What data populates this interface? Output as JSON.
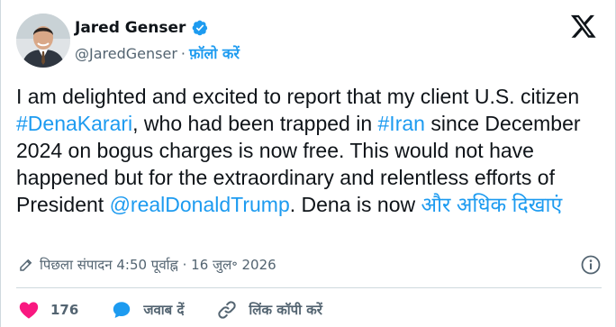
{
  "author": {
    "name": "Jared Genser",
    "handle": "@JaredGenser",
    "separator": "·",
    "follow_label": "फ़ॉलो करें"
  },
  "tweet": {
    "segments": [
      {
        "text": "I am delighted and excited to report that my client U.S. citizen ",
        "type": "text"
      },
      {
        "text": "#DenaKarari",
        "type": "link"
      },
      {
        "text": ", who had been trapped in ",
        "type": "text"
      },
      {
        "text": "#Iran",
        "type": "link"
      },
      {
        "text": " since December 2024 on bogus charges is now free. This would not have happened but for the extraordinary and relentless efforts of President ",
        "type": "text"
      },
      {
        "text": "@realDonaldTrump",
        "type": "link"
      },
      {
        "text": ". Dena is now ",
        "type": "text"
      },
      {
        "text": "और अधिक दिखाएं",
        "type": "link"
      }
    ]
  },
  "meta": {
    "edited_text": "पिछला संपादन 4:50 पूर्वाह्न · 16 जुल॰ 2026"
  },
  "actions": {
    "likes": "176",
    "reply_label": "जवाब दें",
    "copy_link_label": "लिंक कॉपी करें"
  },
  "colors": {
    "accent": "#1d9bf0",
    "like": "#f91880",
    "text": "#0f1419",
    "muted": "#536471"
  }
}
